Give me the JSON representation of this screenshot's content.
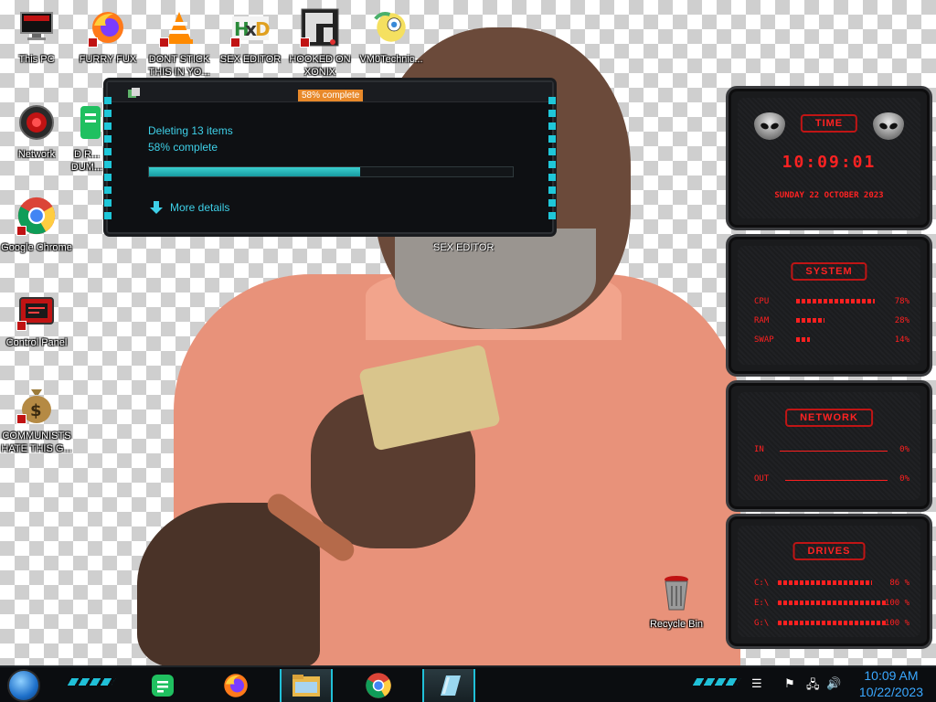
{
  "desktop": {
    "icons": [
      {
        "label": "This PC",
        "icon": "monitor-icon"
      },
      {
        "label": "FURRY FUX",
        "icon": "firefox-icon"
      },
      {
        "label": "DONT STICK THIS IN YO...",
        "icon": "vlc-icon"
      },
      {
        "label": "SEX EDITOR",
        "icon": "hxd-icon"
      },
      {
        "label": "HOOKED ON XONIX",
        "icon": "xonix-icon"
      },
      {
        "label": "VM0Technic...",
        "icon": "anime-icon"
      },
      {
        "label": "Network",
        "icon": "network-icon"
      },
      {
        "label": "D R... DUM...",
        "icon": "green-app-icon"
      },
      {
        "label": "Google Chrome",
        "icon": "chrome-icon"
      },
      {
        "label": "Control Panel",
        "icon": "control-panel-icon"
      },
      {
        "label": "COMMUNISTS HATE THIS G...",
        "icon": "money-bag-icon"
      },
      {
        "label": "Recycle Bin",
        "icon": "recycle-bin-icon"
      }
    ],
    "wallpaper_label": "SEX EDITOR"
  },
  "dialog": {
    "title": "58% complete",
    "line1": "Deleting 13 items",
    "line2": "58% complete",
    "progress": 0.58,
    "more_details": "More details"
  },
  "gadgets": {
    "time": {
      "title": "TIME",
      "clock": "10:09:01",
      "date": "SUNDAY 22 OCTOBER 2023"
    },
    "system": {
      "title": "SYSTEM",
      "rows": [
        {
          "label": "CPU",
          "value": "78%",
          "level": 0.78
        },
        {
          "label": "RAM",
          "value": "28%",
          "level": 0.28
        },
        {
          "label": "SWAP",
          "value": "14%",
          "level": 0.14
        }
      ]
    },
    "network": {
      "title": "NETWORK",
      "in_label": "IN",
      "in_value": "0%",
      "out_label": "OUT",
      "out_value": "0%"
    },
    "drives": {
      "title": "DRIVES",
      "rows": [
        {
          "label": "C:\\",
          "value": "86 %",
          "level": 0.86
        },
        {
          "label": "E:\\",
          "value": "100 %",
          "level": 1.0
        },
        {
          "label": "G:\\",
          "value": "100 %",
          "level": 1.0
        }
      ]
    }
  },
  "taskbar": {
    "apps": [
      "greenshot-icon",
      "firefox-icon",
      "file-explorer-icon",
      "chrome-icon",
      "window-app-icon"
    ],
    "clock_time": "10:09 AM",
    "clock_date": "10/22/2023"
  },
  "colors": {
    "accent_cyan": "#20c0d8",
    "gadget_red": "#ff2020",
    "dialog_bg": "#0e1013"
  }
}
